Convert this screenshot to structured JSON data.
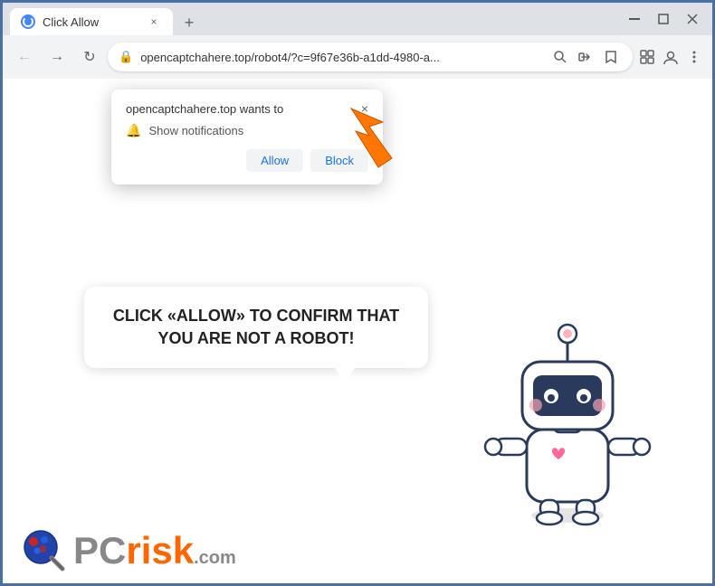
{
  "titlebar": {
    "tab_title": "Click Allow",
    "close_btn": "×",
    "minimize_btn": "—",
    "maximize_btn": "❐",
    "new_tab_btn": "+"
  },
  "navbar": {
    "back_btn": "←",
    "forward_btn": "→",
    "refresh_btn": "↻",
    "address": "opencaptchahere.top/robot4/?c=9f67e36b-a1dd-4980-a...",
    "lock_icon": "🔒"
  },
  "notification_popup": {
    "title": "opencaptchahere.top wants to",
    "notification_row": "Show notifications",
    "allow_label": "Allow",
    "block_label": "Block",
    "close_label": "×"
  },
  "speech_bubble": {
    "text": "CLICK «ALLOW» TO CONFIRM THAT YOU ARE NOT A ROBOT!"
  },
  "logo": {
    "pc": "PC",
    "risk": "risk",
    "dot_com": ".com"
  },
  "colors": {
    "accent_blue": "#2a5298",
    "allow_color": "#1a73e8",
    "orange": "#ff6600"
  }
}
